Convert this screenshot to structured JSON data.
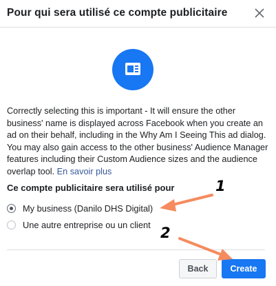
{
  "dialog": {
    "title": "Pour qui sera utilisé ce compte publicitaire",
    "close_icon": "close-icon",
    "hero_icon": "ad-account-card-icon",
    "accent_color": "#1877f2"
  },
  "description": {
    "text": "Correctly selecting this is important - It will ensure the other business' name is displayed across Facebook when you create an ad on their behalf, including in the Why Am I Seeing This ad dialog. You may also gain access to the other business' Audience Manager features including their Custom Audience sizes and the audience overlap tool.",
    "link": "En savoir plus"
  },
  "usage": {
    "heading": "Ce compte publicitaire sera utilisé pour",
    "options": [
      {
        "label": "My business (Danilo DHS Digital)",
        "selected": true
      },
      {
        "label": "Une autre entreprise ou un client",
        "selected": false
      }
    ]
  },
  "footer": {
    "back_label": "Back",
    "create_label": "Create"
  },
  "annotations": {
    "step1": "1",
    "step2": "2",
    "arrow_color": "#f58b5e"
  }
}
